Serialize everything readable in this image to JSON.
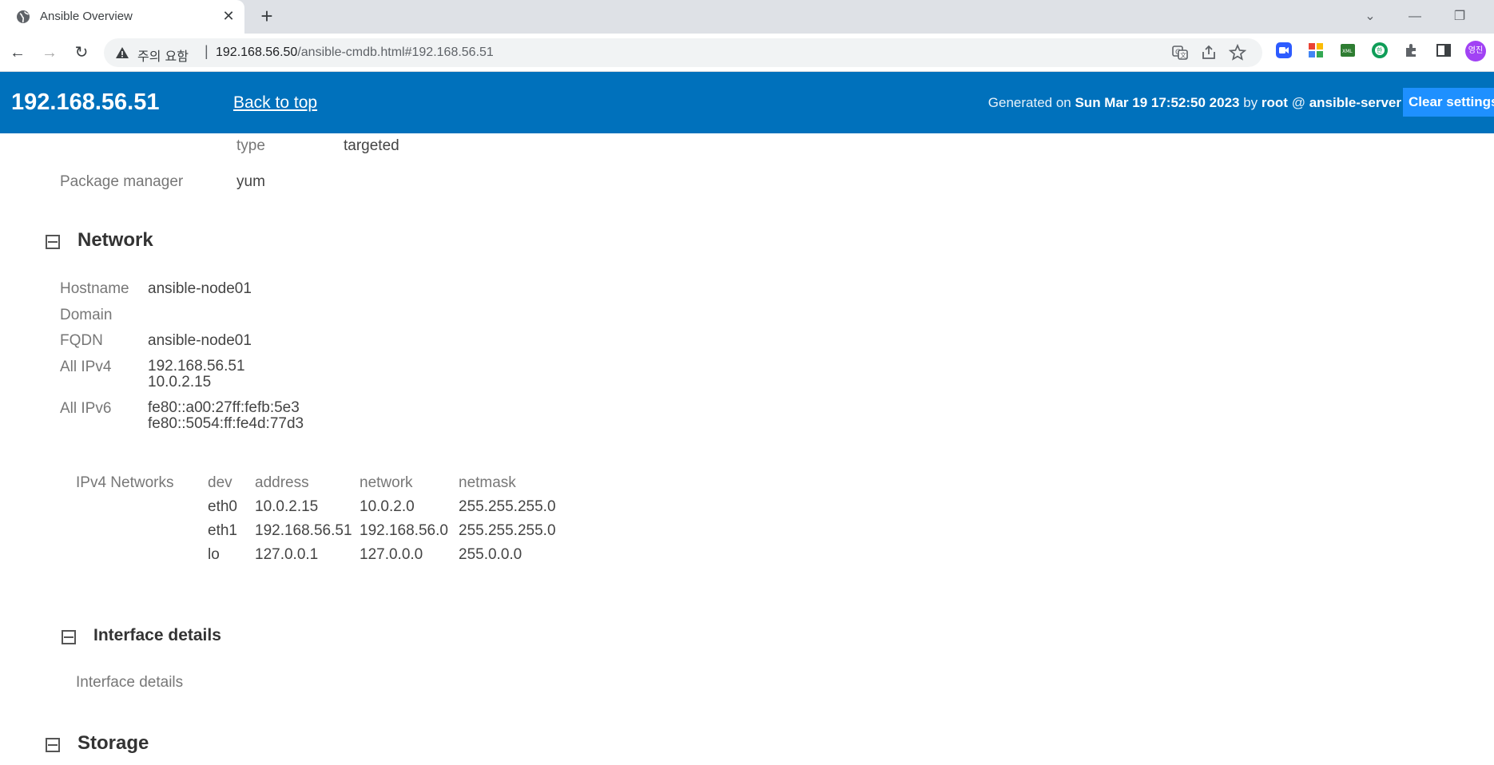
{
  "browser": {
    "tab_title": "Ansible Overview",
    "warning_text": "주의 요함",
    "url_host": "192.168.56.50",
    "url_path": "/ansible-cmdb.html#192.168.56.51",
    "profile_initials": "영진"
  },
  "header": {
    "host": "192.168.56.51",
    "back_to_top": "Back to top",
    "generated_prefix": "Generated on",
    "generated_date": "Sun Mar 19 17:52:50 2023",
    "generated_by": "by",
    "generated_user": "root",
    "generated_at": "@",
    "generated_server": "ansible-server",
    "clear_settings": "Clear settings"
  },
  "selinux": {
    "type_key": "type",
    "type_value": "targeted"
  },
  "package_manager": {
    "key": "Package manager",
    "value": "yum"
  },
  "network": {
    "title": "Network",
    "hostname_key": "Hostname",
    "hostname_value": "ansible-node01",
    "domain_key": "Domain",
    "domain_value": "",
    "fqdn_key": "FQDN",
    "fqdn_value": "ansible-node01",
    "ipv4_key": "All IPv4",
    "ipv4_values": [
      "192.168.56.51",
      "10.0.2.15"
    ],
    "ipv6_key": "All IPv6",
    "ipv6_values": [
      "fe80::a00:27ff:fefb:5e3",
      "fe80::5054:ff:fe4d:77d3"
    ],
    "ipv4_networks_label": "IPv4 Networks",
    "columns": [
      "dev",
      "address",
      "network",
      "netmask"
    ],
    "rows": [
      [
        "eth0",
        "10.0.2.15",
        "10.0.2.0",
        "255.255.255.0"
      ],
      [
        "eth1",
        "192.168.56.51",
        "192.168.56.0",
        "255.255.255.0"
      ],
      [
        "lo",
        "127.0.0.1",
        "127.0.0.0",
        "255.0.0.0"
      ]
    ]
  },
  "interface_details": {
    "title": "Interface details",
    "body": "Interface details"
  },
  "storage": {
    "title": "Storage"
  },
  "colors": {
    "header_bg": "#0071bc",
    "clear_btn_bg": "#1e90ff"
  }
}
